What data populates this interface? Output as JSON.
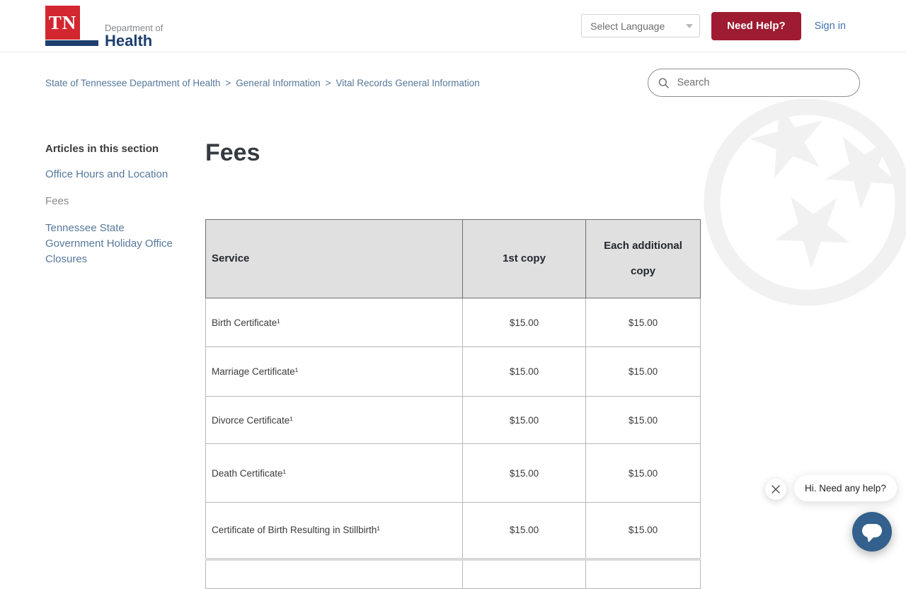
{
  "header": {
    "logo": {
      "tn": "TN",
      "department_of": "Department of",
      "health": "Health"
    },
    "language_selector": {
      "label": "Select Language",
      "icon": "caret-down-icon"
    },
    "need_help_label": "Need Help?",
    "sign_in_label": "Sign in"
  },
  "breadcrumb": {
    "separator": ">",
    "items": [
      {
        "label": "State of Tennessee Department of Health"
      },
      {
        "label": "General Information"
      },
      {
        "label": "Vital Records General Information"
      }
    ]
  },
  "search": {
    "placeholder": "Search",
    "icon": "search-icon"
  },
  "sidebar": {
    "title": "Articles in this section",
    "items": [
      {
        "label": "Office Hours and Location",
        "current": false
      },
      {
        "label": "Fees",
        "current": true
      },
      {
        "label": "Tennessee State Government Holiday Office Closures",
        "current": false
      }
    ]
  },
  "article": {
    "title": "Fees",
    "table": {
      "columns": [
        "Service",
        "1st copy",
        "Each additional copy"
      ],
      "rows": [
        {
          "service": "Birth Certificate¹",
          "first_copy": "$15.00",
          "additional_copy": "$15.00"
        },
        {
          "service": "Marriage Certificate¹",
          "first_copy": "$15.00",
          "additional_copy": "$15.00"
        },
        {
          "service": "Divorce Certificate¹",
          "first_copy": "$15.00",
          "additional_copy": "$15.00"
        },
        {
          "service": "Death Certificate¹",
          "first_copy": "$15.00",
          "additional_copy": "$15.00"
        },
        {
          "service": "Certificate of Birth Resulting in Stillbirth¹",
          "first_copy": "$15.00",
          "additional_copy": "$15.00"
        }
      ]
    }
  },
  "chat": {
    "greeting": "Hi. Need any help?",
    "close_icon": "close-icon",
    "button_icon": "chat-bubble-icon"
  },
  "colors": {
    "tn_red": "#d22730",
    "tn_navy": "#1d3e6e",
    "need_help_maroon": "#9e1b32",
    "link_blue": "#56789b",
    "sign_in_blue": "#3f72ad",
    "chat_blue": "#33608c",
    "table_header_bg": "#e0e0e0",
    "tristar_gray": "#f1f1f2"
  }
}
